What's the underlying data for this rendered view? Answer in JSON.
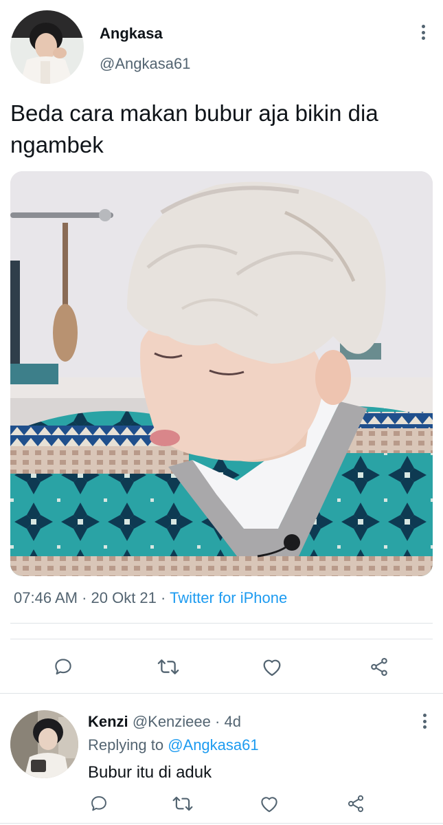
{
  "tweet": {
    "display_name": "Angkasa",
    "handle": "@Angkasa61",
    "text": "Beda cara makan bubur aja bikin dia ngambek",
    "time": "07:46 AM",
    "separator": " · ",
    "date": "20 Okt 21",
    "source": "Twitter for iPhone",
    "actions": [
      "reply-icon",
      "retweet-icon",
      "like-icon",
      "share-icon"
    ]
  },
  "reply": {
    "display_name": "Kenzi",
    "handle": "@Kenzieee",
    "separator": " · ",
    "age": "4d",
    "replying_prefix": "Replying to ",
    "replying_to": "@Angkasa61",
    "text": "Bubur itu di aduk",
    "actions": [
      "reply-icon",
      "retweet-icon",
      "like-icon",
      "share-icon"
    ]
  },
  "colors": {
    "text_primary": "#0f1419",
    "text_secondary": "#536471",
    "link": "#1d9bf0",
    "divider": "#dfe3e6"
  }
}
